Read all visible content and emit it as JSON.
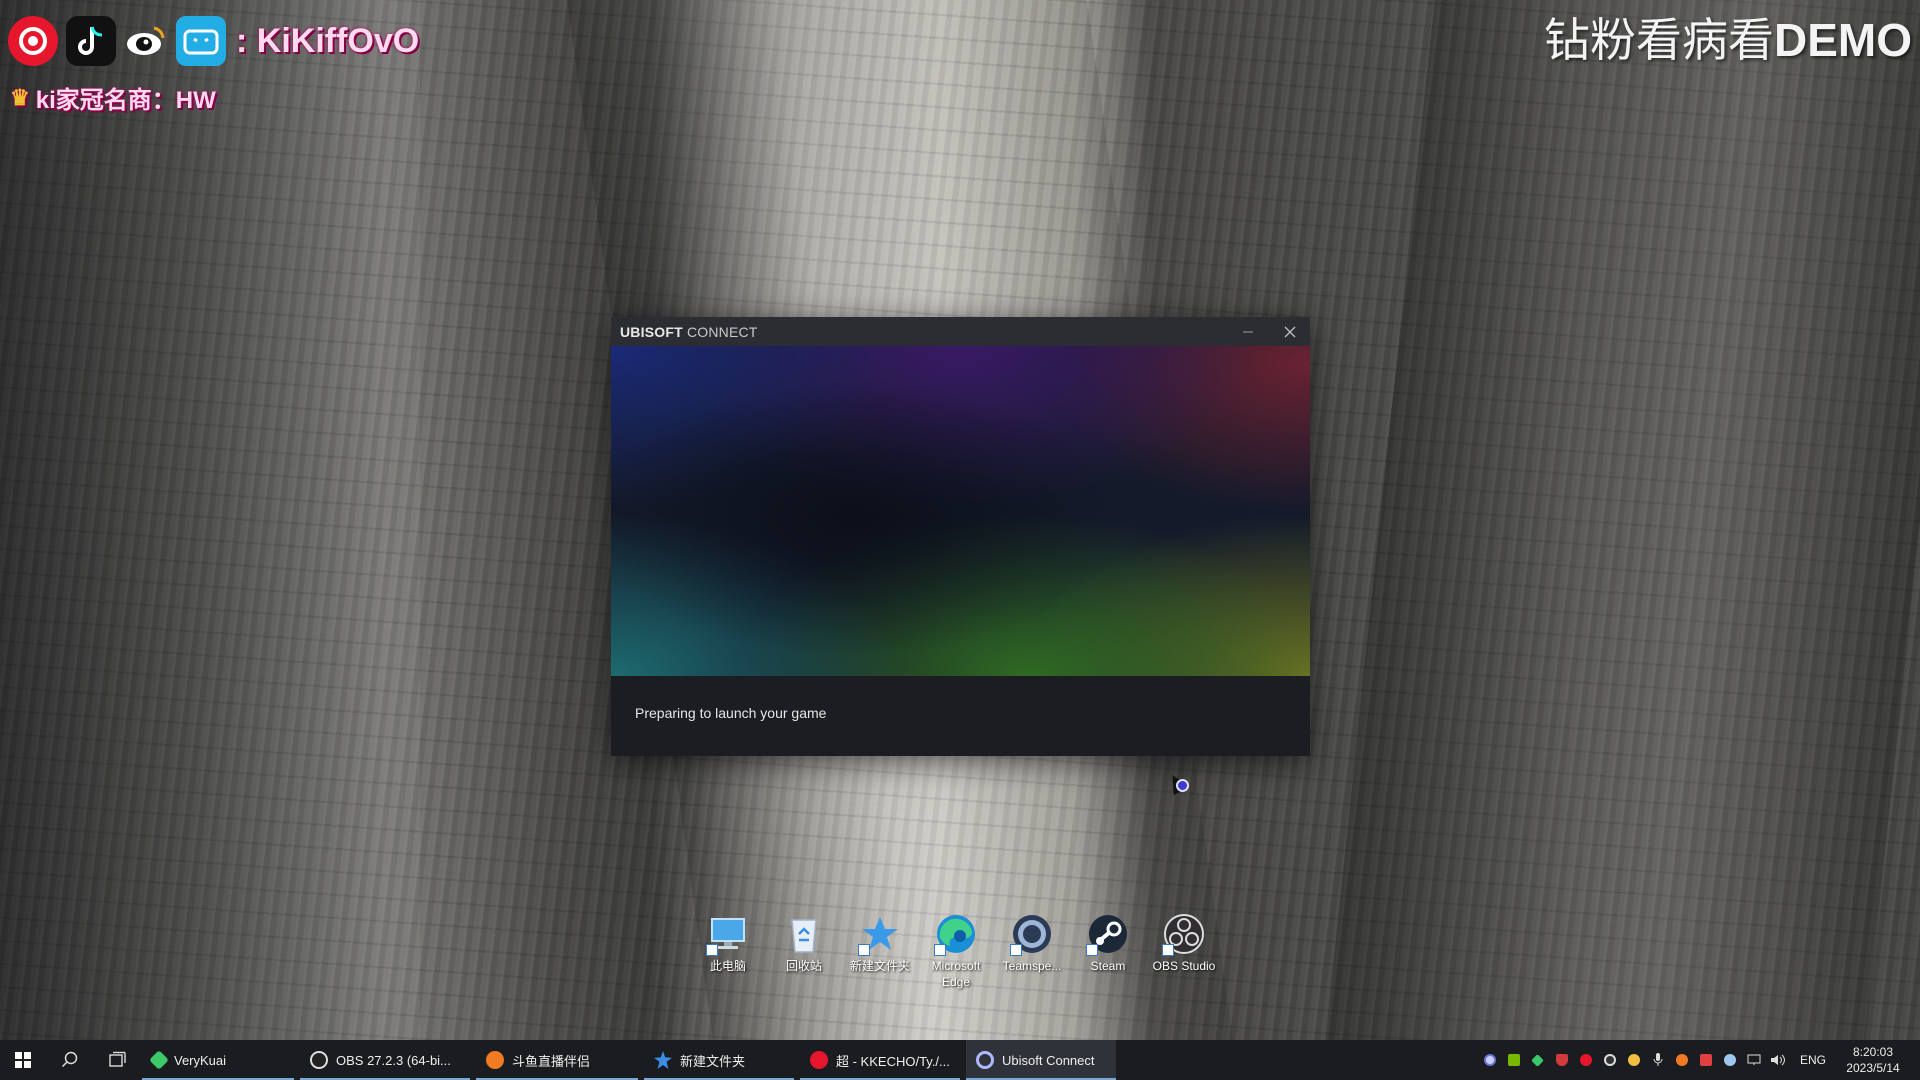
{
  "overlay": {
    "streamer_name": ": KiKiffOvO",
    "sponsor": "ki家冠名商：HW",
    "title_cn": "钻粉看病看",
    "title_latin": "DEMO",
    "icons": [
      "weibo-icon",
      "tiktok-icon",
      "weibo-eye-icon",
      "bilibili-icon",
      "crown-icon"
    ]
  },
  "ubisoft_window": {
    "brand_bold": "UBISOFT",
    "brand_light": "CONNECT",
    "status": "Preparing to launch your game",
    "colors": {
      "titlebar": "#2b2d33",
      "body": "#1b1d22"
    }
  },
  "desktop": {
    "icons": [
      {
        "label": "此电脑",
        "icon": "this-pc-icon"
      },
      {
        "label": "回收站",
        "icon": "recycle-bin-icon"
      },
      {
        "label": "新建文件夹",
        "icon": "star-folder-icon"
      },
      {
        "label": "Microsoft Edge",
        "icon": "edge-icon"
      },
      {
        "label": "Teamspe...",
        "icon": "teamspeak-icon"
      },
      {
        "label": "Steam",
        "icon": "steam-icon"
      },
      {
        "label": "OBS Studio",
        "icon": "obs-icon"
      }
    ]
  },
  "taskbar": {
    "apps": [
      {
        "label": "VeryKuai",
        "color": "#3cc96a"
      },
      {
        "label": "OBS 27.2.3 (64-bi...",
        "color": "#222222"
      },
      {
        "label": "斗鱼直播伴侣",
        "color": "#f07b22"
      },
      {
        "label": "新建文件夹",
        "color": "#3a8ee6"
      },
      {
        "label": "超 - KKECHO/Ty./...",
        "color": "#e6162d"
      },
      {
        "label": "Ubisoft Connect",
        "color": "#b0b8ff"
      }
    ],
    "language": "ENG",
    "time": "8:20:03",
    "date": "2023/5/14"
  }
}
